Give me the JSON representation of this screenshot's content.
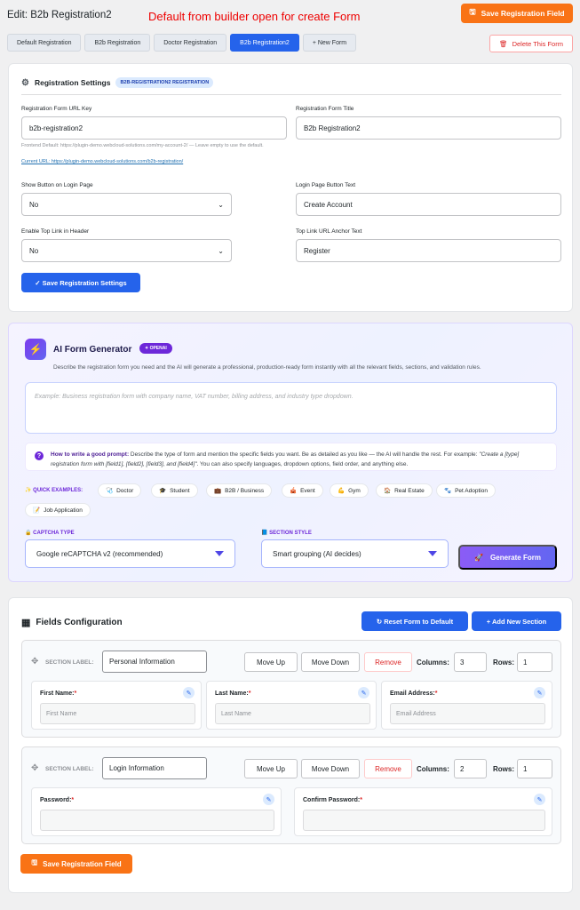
{
  "header": {
    "title": "Edit: B2b Registration2",
    "annotation": "Default from builder open for create Form",
    "save_label": "Save Registration Field"
  },
  "tabs": [
    {
      "label": "Default Registration",
      "active": false
    },
    {
      "label": "B2b Registration",
      "active": false
    },
    {
      "label": "Doctor Registration",
      "active": false
    },
    {
      "label": "B2b Registration2",
      "active": true
    },
    {
      "label": "+ New Form",
      "active": false
    }
  ],
  "delete_label": "Delete This Form",
  "registration_settings": {
    "title": "Registration Settings",
    "badge": "B2B-REGISTRATION2 REGISTRATION",
    "url_key_label": "Registration Form URL Key",
    "url_key_value": "b2b-registration2",
    "url_hint": "Frontend Default: https://plugin-demo.webcloud-solutions.com/my-account-2/ — Leave empty to use the default.",
    "current_url": "Current URL: https://plugin-demo.webcloud-solutions.com/b2b-registration/",
    "form_title_label": "Registration Form Title",
    "form_title_value": "B2b Registration2",
    "show_button_label": "Show Button on Login Page",
    "show_button_value": "No",
    "login_btn_text_label": "Login Page Button Text",
    "login_btn_text_value": "Create Account",
    "top_link_label": "Enable Top Link in Header",
    "top_link_value": "No",
    "anchor_text_label": "Top Link URL Anchor Text",
    "anchor_text_value": "Register",
    "save_label": "✓ Save Registration Settings"
  },
  "ai_generator": {
    "title": "AI Form Generator",
    "badge": "✦ OPENAI",
    "description": "Describe the registration form you need and the AI will generate a professional, production-ready form instantly with all the relevant fields, sections, and validation rules.",
    "placeholder": "Example: Business registration form with company name, VAT number, billing address, and industry type dropdown.",
    "tip_bold": "How to write a good prompt:",
    "tip_text": " Describe the type of form and mention the specific fields you want. Be as detailed as you like — the AI will handle the rest. For example: ",
    "tip_example": "\"Create a [type] registration form with [field1], [field2], [field3], and [field4]\"",
    "tip_end": ". You can also specify languages, dropdown options, field order, and anything else.",
    "quick_label": "QUICK EXAMPLES:",
    "quick_examples": [
      "Doctor",
      "Student",
      "B2B / Business",
      "Event",
      "Gym",
      "Real Estate",
      "Pet Adoption",
      "Job Application"
    ],
    "captcha_label": "CAPTCHA TYPE",
    "captcha_value": "Google reCAPTCHA v2 (recommended)",
    "section_style_label": "SECTION STYLE",
    "section_style_value": "Smart grouping (AI decides)",
    "generate_label": "Generate Form"
  },
  "fields_config": {
    "title": "Fields Configuration",
    "reset_label": "↻ Reset Form to Default",
    "add_section_label": "+ Add New Section",
    "section_label_text": "SECTION LABEL:",
    "move_up": "Move Up",
    "move_down": "Move Down",
    "remove": "Remove",
    "columns_label": "Columns:",
    "rows_label": "Rows:",
    "sections": [
      {
        "name": "Personal Information",
        "columns": "3",
        "rows": "1",
        "fields": [
          {
            "label": "First Name:",
            "placeholder": "First Name"
          },
          {
            "label": "Last Name:",
            "placeholder": "Last Name"
          },
          {
            "label": "Email Address:",
            "placeholder": "Email Address"
          }
        ]
      },
      {
        "name": "Login Information",
        "columns": "2",
        "rows": "1",
        "fields": [
          {
            "label": "Password:",
            "placeholder": ""
          },
          {
            "label": "Confirm Password:",
            "placeholder": ""
          }
        ]
      }
    ],
    "save_label": "Save Registration Field"
  }
}
